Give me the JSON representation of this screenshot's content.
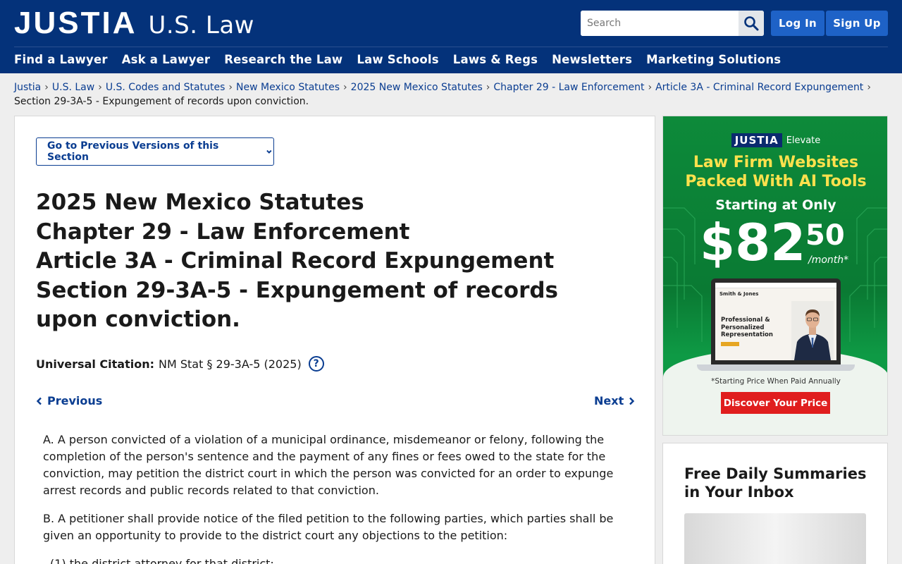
{
  "header": {
    "logo_main": "JUSTIA",
    "logo_sub": "U.S. Law",
    "search_placeholder": "Search",
    "login_label": "Log In",
    "signup_label": "Sign Up",
    "colors": {
      "bar": "#04327a",
      "button": "#1e62c7"
    }
  },
  "nav": {
    "items": [
      {
        "label": "Find a Lawyer"
      },
      {
        "label": "Ask a Lawyer"
      },
      {
        "label": "Research the Law"
      },
      {
        "label": "Law Schools"
      },
      {
        "label": "Laws & Regs"
      },
      {
        "label": "Newsletters"
      },
      {
        "label": "Marketing Solutions"
      }
    ]
  },
  "breadcrumb": {
    "links": [
      "Justia",
      "U.S. Law",
      "U.S. Codes and Statutes",
      "New Mexico Statutes",
      "2025 New Mexico Statutes",
      "Chapter 29 - Law Enforcement",
      "Article 3A - Criminal Record Expungement"
    ],
    "current": "Section 29-3A-5 - Expungement of records upon conviction."
  },
  "main": {
    "prev_versions_label": "Go to Previous Versions of this Section",
    "title_lines": [
      "2025 New Mexico Statutes",
      "Chapter 29 - Law Enforcement",
      "Article 3A - Criminal Record Expungement",
      "Section 29-3A-5 - Expungement of records upon conviction."
    ],
    "citation_label": "Universal Citation:",
    "citation_value": "NM Stat § 29-3A-5 (2025)",
    "help_label": "?",
    "previous_label": "Previous",
    "next_label": "Next",
    "paragraphs": [
      "A. A person convicted of a violation of a municipal ordinance, misdemeanor or felony, following the completion of the person's sentence and the payment of any fines or fees owed to the state for the conviction, may petition the district court in which the person was convicted for an order to expunge arrest records and public records related to that conviction.",
      "B. A petitioner shall provide notice of the filed petition to the following parties, which parties shall be given an opportunity to provide to the district court any objections to the petition:",
      "(1) the district attorney for that district;"
    ]
  },
  "ad": {
    "brand": "JUSTIA",
    "brand_sub": "Elevate",
    "headline_1": "Law Firm Websites",
    "headline_2": "Packed With AI Tools",
    "starting": "Starting at Only",
    "price_dollars": "$82",
    "price_cents": "50",
    "price_period": "/month*",
    "screen_logo": "Smith & Jones",
    "screen_text_1": "Professional &",
    "screen_text_2": "Personalized",
    "screen_text_3": "Representation",
    "note": "*Starting Price When Paid Annually",
    "cta": "Discover Your Price"
  },
  "newsletter": {
    "title": "Free Daily Summaries in Your Inbox"
  }
}
